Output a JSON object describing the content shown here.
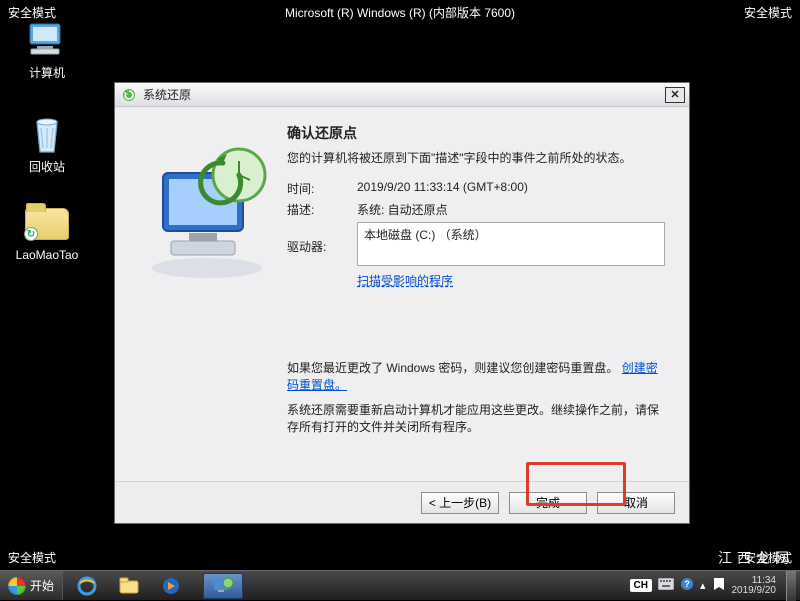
{
  "safemode_label": "安全模式",
  "windows_version": "Microsoft (R) Windows (R) (内部版本 7600)",
  "desktop": {
    "computer": "计算机",
    "recyclebin": "回收站",
    "shortcut": "LaoMaoTao"
  },
  "dialog": {
    "title": "系统还原",
    "heading": "确认还原点",
    "lead": "您的计算机将被还原到下面\"描述\"字段中的事件之前所处的状态。",
    "time_label": "时间:",
    "time_value": "2019/9/20 11:33:14 (GMT+8:00)",
    "desc_label": "描述:",
    "desc_value": "系统: 自动还原点",
    "drives_label": "驱动器:",
    "drive_value": "本地磁盘 (C:) （系统）",
    "scan_link": "扫描受影响的程序",
    "pwd_note_pre": "如果您最近更改了 Windows 密码，则建议您创建密码重置盘。",
    "pwd_link": "创建密码重置盘。",
    "reboot_note": "系统还原需要重新启动计算机才能应用这些更改。继续操作之前，请保存所有打开的文件并关闭所有程序。",
    "buttons": {
      "back": "< 上一步(B)",
      "finish": "完成",
      "cancel": "取消"
    }
  },
  "taskbar": {
    "start": "开始",
    "ime": "CH",
    "clock_time": "11:34",
    "clock_date": "2019/9/20"
  },
  "watermark": "江西龙网"
}
